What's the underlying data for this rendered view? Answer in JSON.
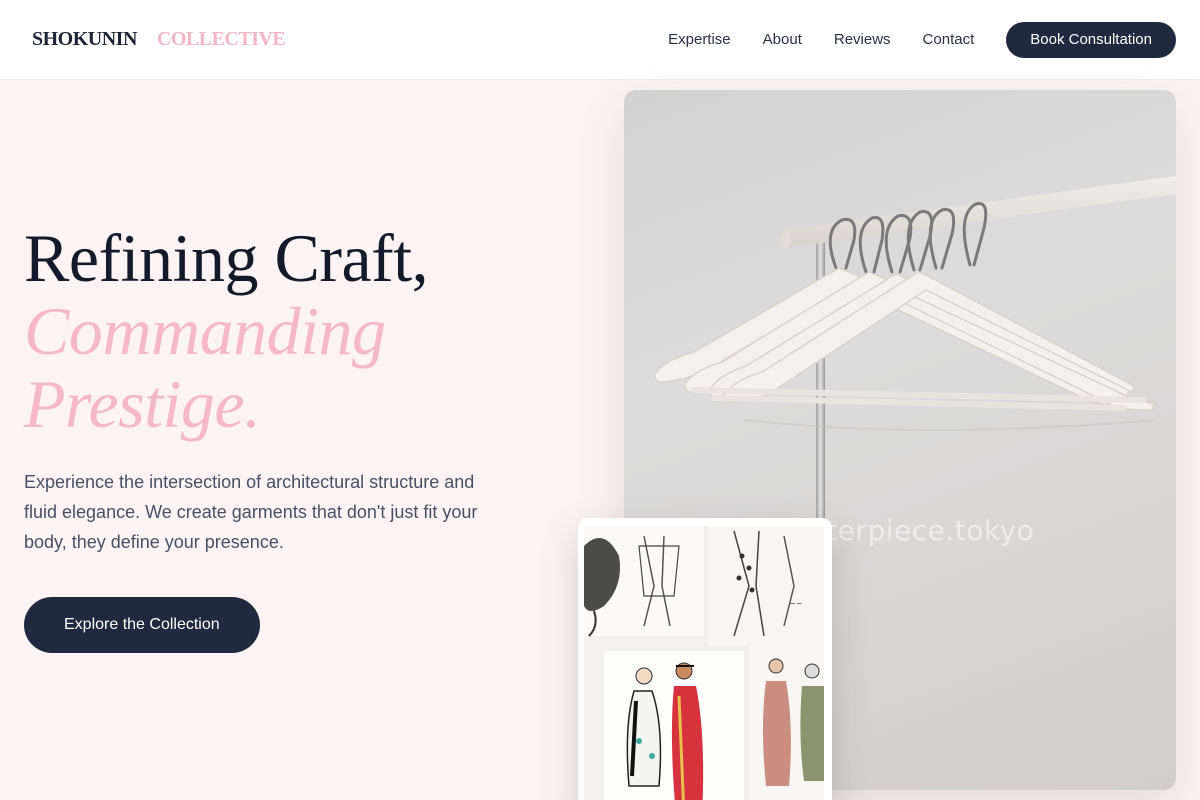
{
  "header": {
    "logo_primary": "SHOKUNIN",
    "logo_accent": "COLLECTIVE",
    "nav": [
      "Expertise",
      "About",
      "Reviews",
      "Contact"
    ],
    "cta_label": "Book Consultation"
  },
  "hero": {
    "title_line1": "Refining Craft,",
    "title_line2": "Commanding",
    "title_line3": "Prestige.",
    "description": "Experience the intersection of architectural structure and fluid elegance. We create garments that don't just fit your body, they define your presence.",
    "button_label": "Explore the Collection"
  },
  "images": {
    "main_watermark": "masterpiece.tokyo",
    "main_subject": "hangers-on-rack",
    "secondary_subject": "fashion-sketches"
  },
  "colors": {
    "navy": "#1f2940",
    "pink": "#f6b8c8",
    "background": "#fcf4f4"
  }
}
